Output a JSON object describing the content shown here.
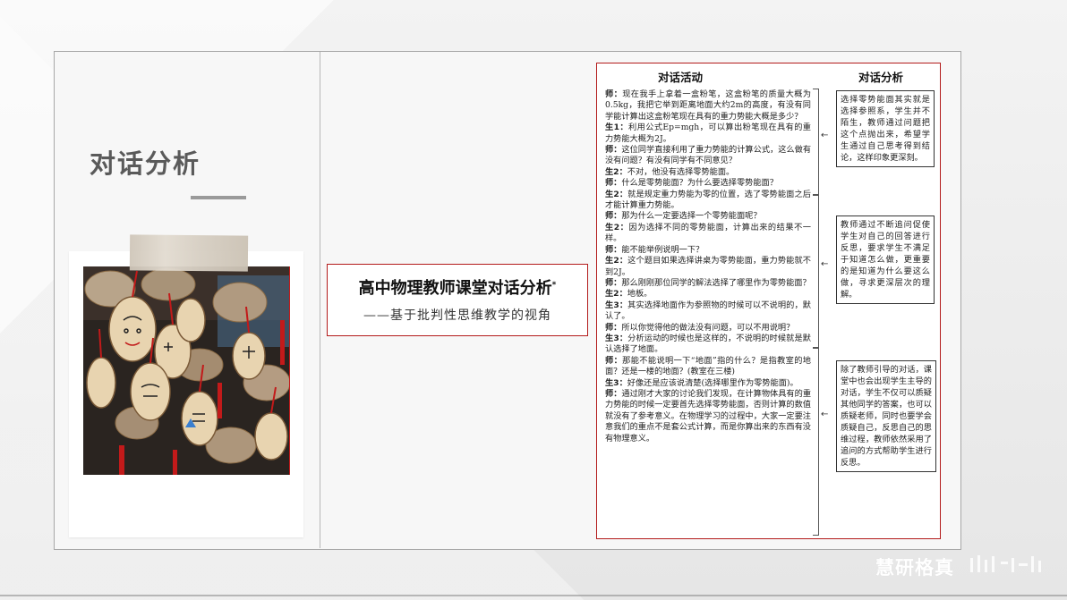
{
  "slide": {
    "section_title": "对话分析"
  },
  "paper": {
    "title": "高中物理教师课堂对话分析",
    "title_mark": "*",
    "subtitle": "——基于批判性思维教学的视角"
  },
  "article": {
    "col1_header": "对话活动",
    "col2_header": "对话分析",
    "turns": [
      {
        "speaker": "师：",
        "text": "现在我手上拿着一盒粉笔，这盒粉笔的质量大概为0.5kg，我把它举到距离地面大约2m的高度，有没有同学能计算出这盒粉笔现在具有的重力势能大概是多少？"
      },
      {
        "speaker": "生1：",
        "text": "利用公式Ep=mgh，可以算出粉笔现在具有的重力势能大概为2J。"
      },
      {
        "speaker": "师：",
        "text": "这位同学直接利用了重力势能的计算公式，这么做有没有问题？有没有同学有不同意见？"
      },
      {
        "speaker": "生2：",
        "text": "不对，他没有选择零势能面。"
      },
      {
        "speaker": "师：",
        "text": "什么是零势能面？为什么要选择零势能面？"
      },
      {
        "speaker": "生2：",
        "text": "就是规定重力势能为零的位置，选了零势能面之后才能计算重力势能。"
      },
      {
        "speaker": "师：",
        "text": "那为什么一定要选择一个零势能面呢？"
      },
      {
        "speaker": "生2：",
        "text": "因为选择不同的零势能面，计算出来的结果不一样。"
      },
      {
        "speaker": "师：",
        "text": "能不能举例说明一下？"
      },
      {
        "speaker": "生2：",
        "text": "这个题目如果选择讲桌为零势能面，重力势能就不到2J。"
      },
      {
        "speaker": "师：",
        "text": "那么刚刚那位同学的解法选择了哪里作为零势能面？"
      },
      {
        "speaker": "生2：",
        "text": "地板。"
      },
      {
        "speaker": "生3：",
        "text": "其实选择地面作为参照物的时候可以不说明的，默认了。"
      },
      {
        "speaker": "师：",
        "text": "所以你觉得他的做法没有问题，可以不用说明？"
      },
      {
        "speaker": "生3：",
        "text": "分析运动的时候也是这样的，不说明的时候就是默认选择了地面。"
      },
      {
        "speaker": "师：",
        "text": "那能不能说明一下“地面”指的什么？是指教室的地面？还是一楼的地面？(教室在三楼)"
      },
      {
        "speaker": "生3：",
        "text": "好像还是应该说清楚(选择哪里作为零势能面)。"
      },
      {
        "speaker": "师：",
        "text": "通过刚才大家的讨论我们发现，在计算物体具有的重力势能的时候一定要首先选择零势能面，否则计算的数值就没有了参考意义。在物理学习的过程中，大家一定要注意我们的重点不是套公式计算，而是你算出来的东西有没有物理意义。"
      }
    ],
    "notes": [
      "选择零势能面其实就是选择参照系，学生并不陌生，教师通过问题把这个点抛出来，希望学生通过自己思考得到结论，这样印象更深刻。",
      "教师通过不断追问促使学生对自己的回答进行反思，要求学生不满足于知道怎么做，更重要的是知道为什么要这么做，寻求更深层次的理解。",
      "除了教师引导的对话，课堂中也会出现学生主导的对话，学生不仅可以质疑其他同学的答案，也可以质疑老师，同时也要学会质疑自己，反思自己的思维过程，教师依然采用了追问的方式帮助学生进行反思。"
    ],
    "arrow_glyph": "←"
  },
  "watermark": {
    "text": "慧研格真"
  },
  "colors": {
    "accent_red": "#b31b1b",
    "title_gray": "#5a5a5a"
  }
}
